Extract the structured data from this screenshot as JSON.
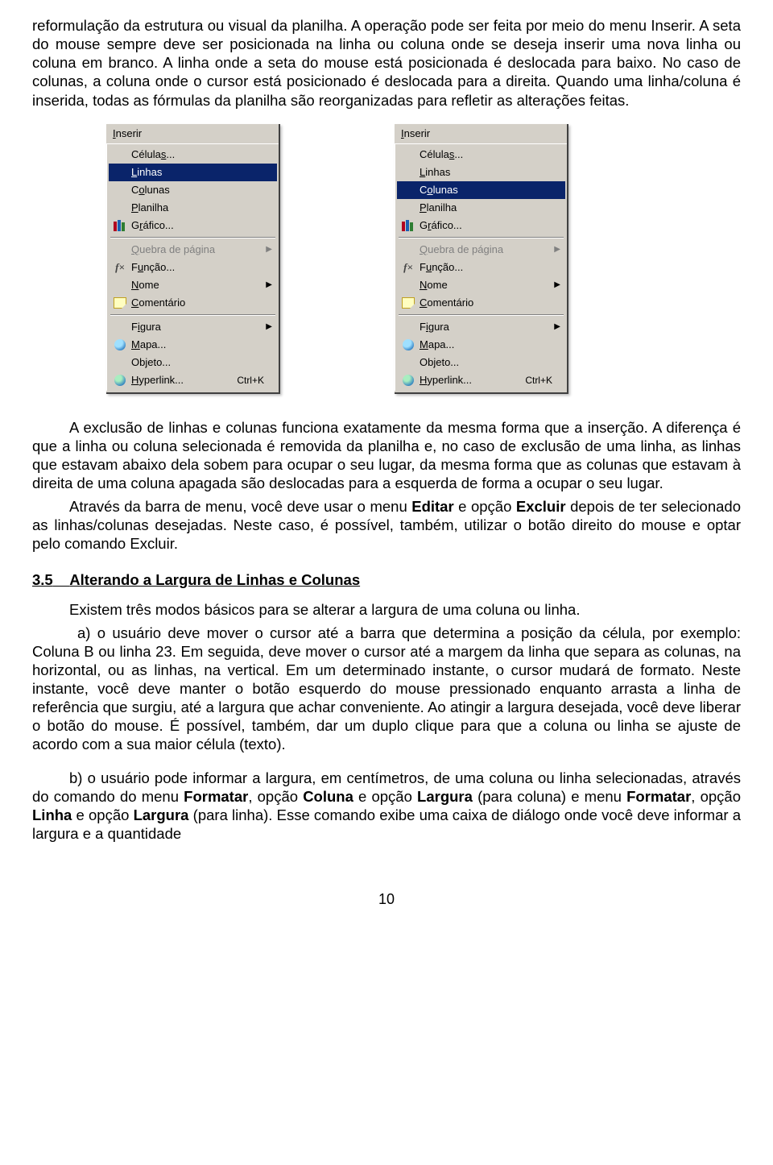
{
  "para1": "reformulação da estrutura ou visual da planilha. A operação pode ser feita por meio do menu Inserir. A seta do mouse sempre deve ser posicionada na linha ou coluna onde se deseja inserir uma nova linha ou coluna em branco. A linha onde a seta do mouse está posicionada é deslocada para baixo. No caso de colunas, a coluna onde o cursor está posicionado é deslocada para a direita. Quando uma linha/coluna é inserida, todas as fórmulas da planilha são reorganizadas para refletir as alterações feitas.",
  "menu_title": "Inserir",
  "menu_items": [
    {
      "label_pre": "Célula",
      "key": "s",
      "label_post": "...",
      "icon": "",
      "sub": false
    },
    {
      "label_pre": "",
      "key": "L",
      "label_post": "inhas",
      "icon": "",
      "sub": false
    },
    {
      "label_pre": "C",
      "key": "o",
      "label_post": "lunas",
      "icon": "",
      "sub": false
    },
    {
      "label_pre": "",
      "key": "P",
      "label_post": "lanilha",
      "icon": "",
      "sub": false
    },
    {
      "label_pre": "G",
      "key": "r",
      "label_post": "áfico...",
      "icon": "books",
      "sub": false
    },
    {
      "sep": true
    },
    {
      "label_pre": "",
      "key": "Q",
      "label_post": "uebra de página",
      "icon": "",
      "sub": true,
      "dis": true
    },
    {
      "label_pre": "F",
      "key": "u",
      "label_post": "nção...",
      "icon": "fx",
      "sub": false
    },
    {
      "label_pre": "",
      "key": "N",
      "label_post": "ome",
      "icon": "",
      "sub": true
    },
    {
      "label_pre": "",
      "key": "C",
      "label_post": "omentário",
      "icon": "note",
      "sub": false
    },
    {
      "sep": true
    },
    {
      "label_pre": "F",
      "key": "i",
      "label_post": "gura",
      "icon": "",
      "sub": true
    },
    {
      "label_pre": "",
      "key": "M",
      "label_post": "apa...",
      "icon": "globe",
      "sub": false
    },
    {
      "label_pre": "Ob",
      "key": "j",
      "label_post": "eto...",
      "icon": "",
      "sub": false
    },
    {
      "label_pre": "",
      "key": "H",
      "label_post": "yperlink...",
      "icon": "globe2",
      "sub": false,
      "shortcut": "Ctrl+K"
    }
  ],
  "menu1_selected": 1,
  "menu2_selected": 2,
  "para2a": "A exclusão de linhas e colunas funciona exatamente da mesma forma que a inserção. A diferença é que a linha ou coluna selecionada é removida da planilha e, no caso de exclusão de uma linha, as linhas que estavam abaixo dela sobem para ocupar o seu lugar, da mesma forma que as colunas que estavam à direita de uma coluna apagada são deslocadas para a esquerda de forma a ocupar o seu lugar.",
  "para2b_pre": "Através da barra de menu, você deve usar o menu ",
  "para2b_b1": "Editar",
  "para2b_mid": " e opção ",
  "para2b_b2": "Excluir",
  "para2b_post": " depois de ter selecionado as linhas/colunas desejadas. Neste caso, é possível, também, utilizar o botão direito do mouse e optar pelo comando Excluir.",
  "heading_num": "3.5",
  "heading_txt": "Alterando a Largura de Linhas e Colunas",
  "para3": "Existem três modos básicos para se alterar a largura de uma coluna ou linha.",
  "para4": "a) o usuário deve mover o cursor até a barra que determina a posição da célula, por exemplo: Coluna B ou linha 23. Em seguida, deve mover o cursor até a margem da linha que separa as colunas, na horizontal, ou as linhas, na vertical. Em um determinado instante, o cursor mudará de formato. Neste instante, você deve manter o botão esquerdo do mouse pressionado enquanto arrasta a linha de referência que surgiu, até a largura que achar conveniente. Ao atingir a largura desejada, você deve liberar o botão do mouse. É possível, também, dar um duplo clique para que a coluna ou linha se ajuste de acordo com a sua maior célula (texto).",
  "para5_pre": "b) o usuário pode informar a largura, em centímetros, de uma coluna ou linha selecionadas, através do comando do menu ",
  "para5_b1": "Formatar",
  "para5_t1": ", opção ",
  "para5_b2": "Coluna",
  "para5_t2": " e opção ",
  "para5_b3": "Largura",
  "para5_t3": " (para coluna) e menu  ",
  "para5_b4": "Formatar",
  "para5_t4": ", opção ",
  "para5_b5": "Linha",
  "para5_t5": " e opção ",
  "para5_b6": "Largura",
  "para5_t6": " (para linha). Esse comando exibe uma caixa de diálogo onde você deve informar a largura e a quantidade",
  "pagenum": "10"
}
